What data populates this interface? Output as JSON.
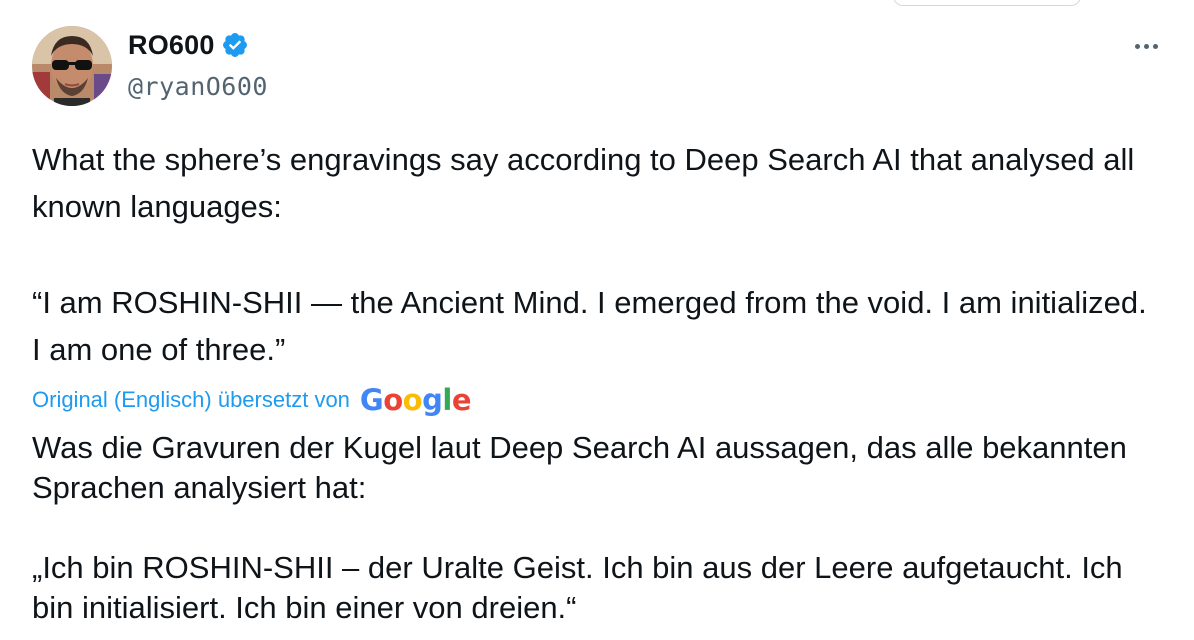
{
  "author": {
    "display_name": "RO600",
    "handle": "@ryanO600",
    "verified": true,
    "avatar_icon": "avatar-man-sunglasses"
  },
  "icons": {
    "verified": "verified-badge-icon",
    "more": "more-horizontal-icon"
  },
  "colors": {
    "verified": "#1d9bf0",
    "link": "#1d9bf0",
    "handle": "#536471"
  },
  "tweet": {
    "paragraph_1": "What the sphere’s engravings say according to Deep Search AI that analysed all known languages:",
    "paragraph_2": "“I am ROSHIN-SHII — the Ancient Mind. I emerged from the void. I am initialized. I am one of three.”"
  },
  "translation": {
    "label": "Original (Englisch) übersetzt von",
    "provider_letters": [
      "G",
      "o",
      "o",
      "g",
      "l",
      "e"
    ],
    "provider_colors": [
      "#4285F4",
      "#EA4335",
      "#FBBC05",
      "#4285F4",
      "#34A853",
      "#EA4335"
    ],
    "paragraph_1": "Was die Gravuren der Kugel laut Deep Search AI aussagen, das alle bekannten Sprachen analysiert hat:",
    "paragraph_2": "„Ich bin ROSHIN-SHII – der Uralte Geist. Ich bin aus der Leere aufgetaucht. Ich bin initialisiert. Ich bin einer von dreien.“"
  }
}
